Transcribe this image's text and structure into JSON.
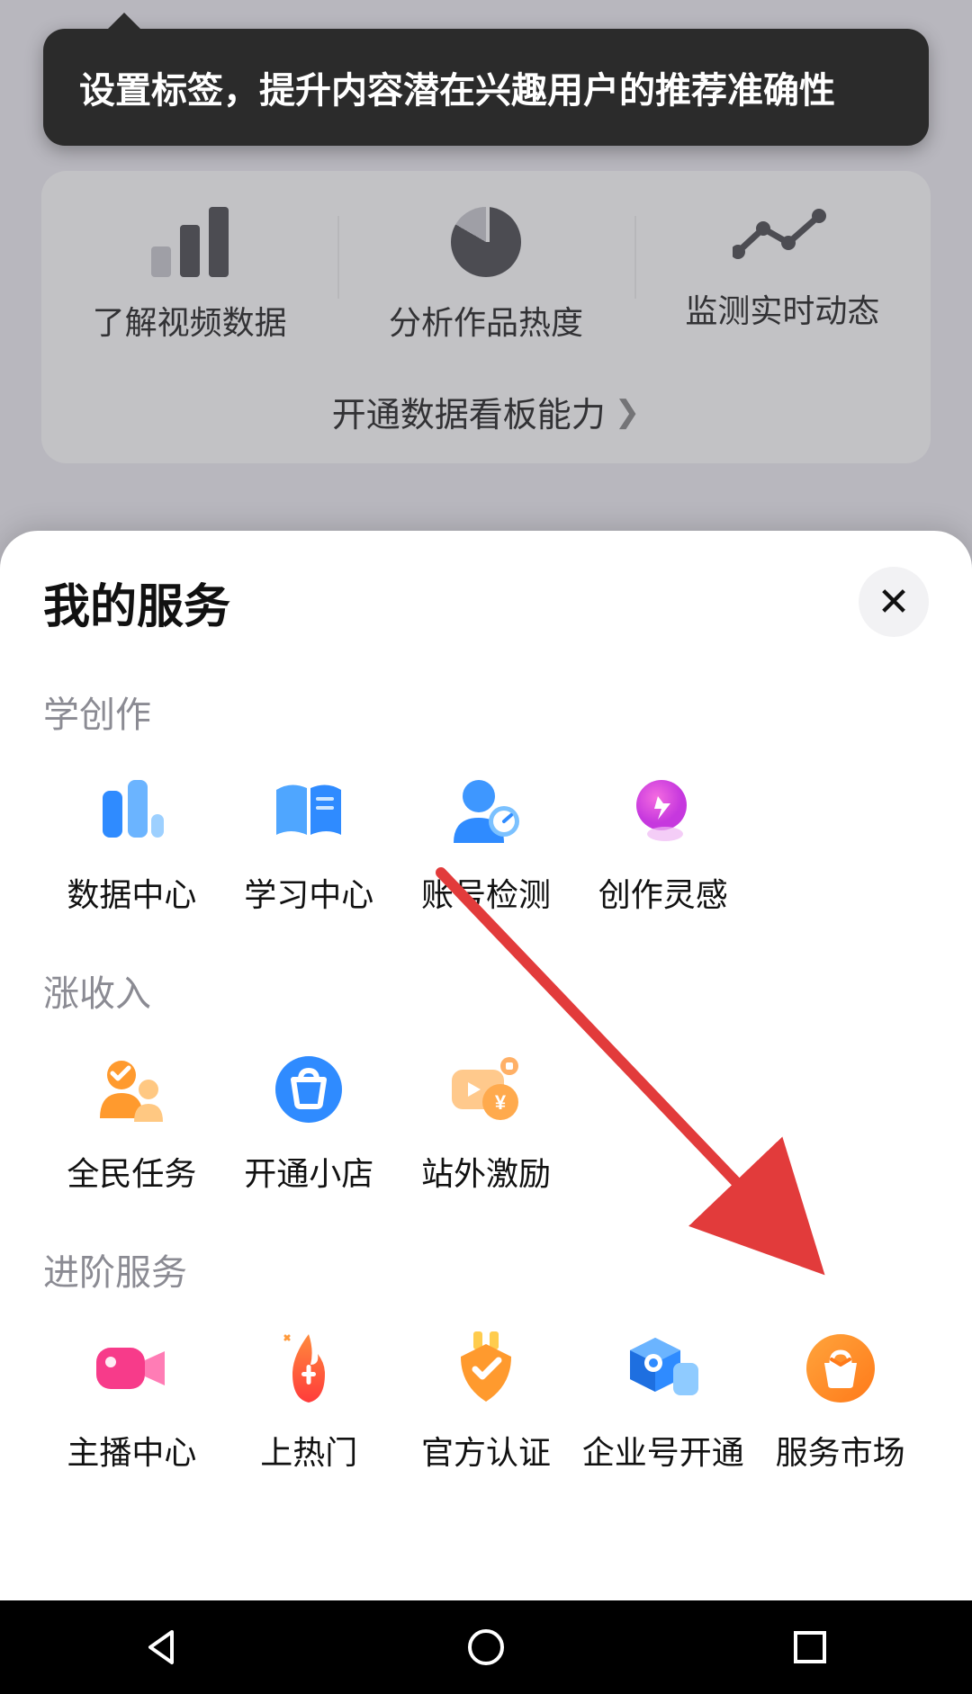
{
  "tooltip": {
    "text": "设置标签，提升内容潜在兴趣用户的推荐准确性"
  },
  "dashboard": {
    "items": [
      {
        "label": "了解视频数据"
      },
      {
        "label": "分析作品热度"
      },
      {
        "label": "监测实时动态"
      }
    ],
    "link": "开通数据看板能力"
  },
  "sheet": {
    "title": "我的服务",
    "sections": [
      {
        "title": "学创作",
        "items": [
          {
            "label": "数据中心",
            "icon": "bar-chart"
          },
          {
            "label": "学习中心",
            "icon": "book"
          },
          {
            "label": "账号检测",
            "icon": "person-gauge"
          },
          {
            "label": "创作灵感",
            "icon": "lightbulb"
          }
        ]
      },
      {
        "title": "涨收入",
        "items": [
          {
            "label": "全民任务",
            "icon": "people"
          },
          {
            "label": "开通小店",
            "icon": "shop"
          },
          {
            "label": "站外激励",
            "icon": "reward"
          }
        ]
      },
      {
        "title": "进阶服务",
        "items": [
          {
            "label": "主播中心",
            "icon": "camera"
          },
          {
            "label": "上热门",
            "icon": "fire"
          },
          {
            "label": "官方认证",
            "icon": "badge"
          },
          {
            "label": "企业号开通",
            "icon": "cube"
          },
          {
            "label": "服务市场",
            "icon": "market"
          }
        ]
      }
    ]
  },
  "annotation": {
    "arrow_target": "服务市场"
  }
}
